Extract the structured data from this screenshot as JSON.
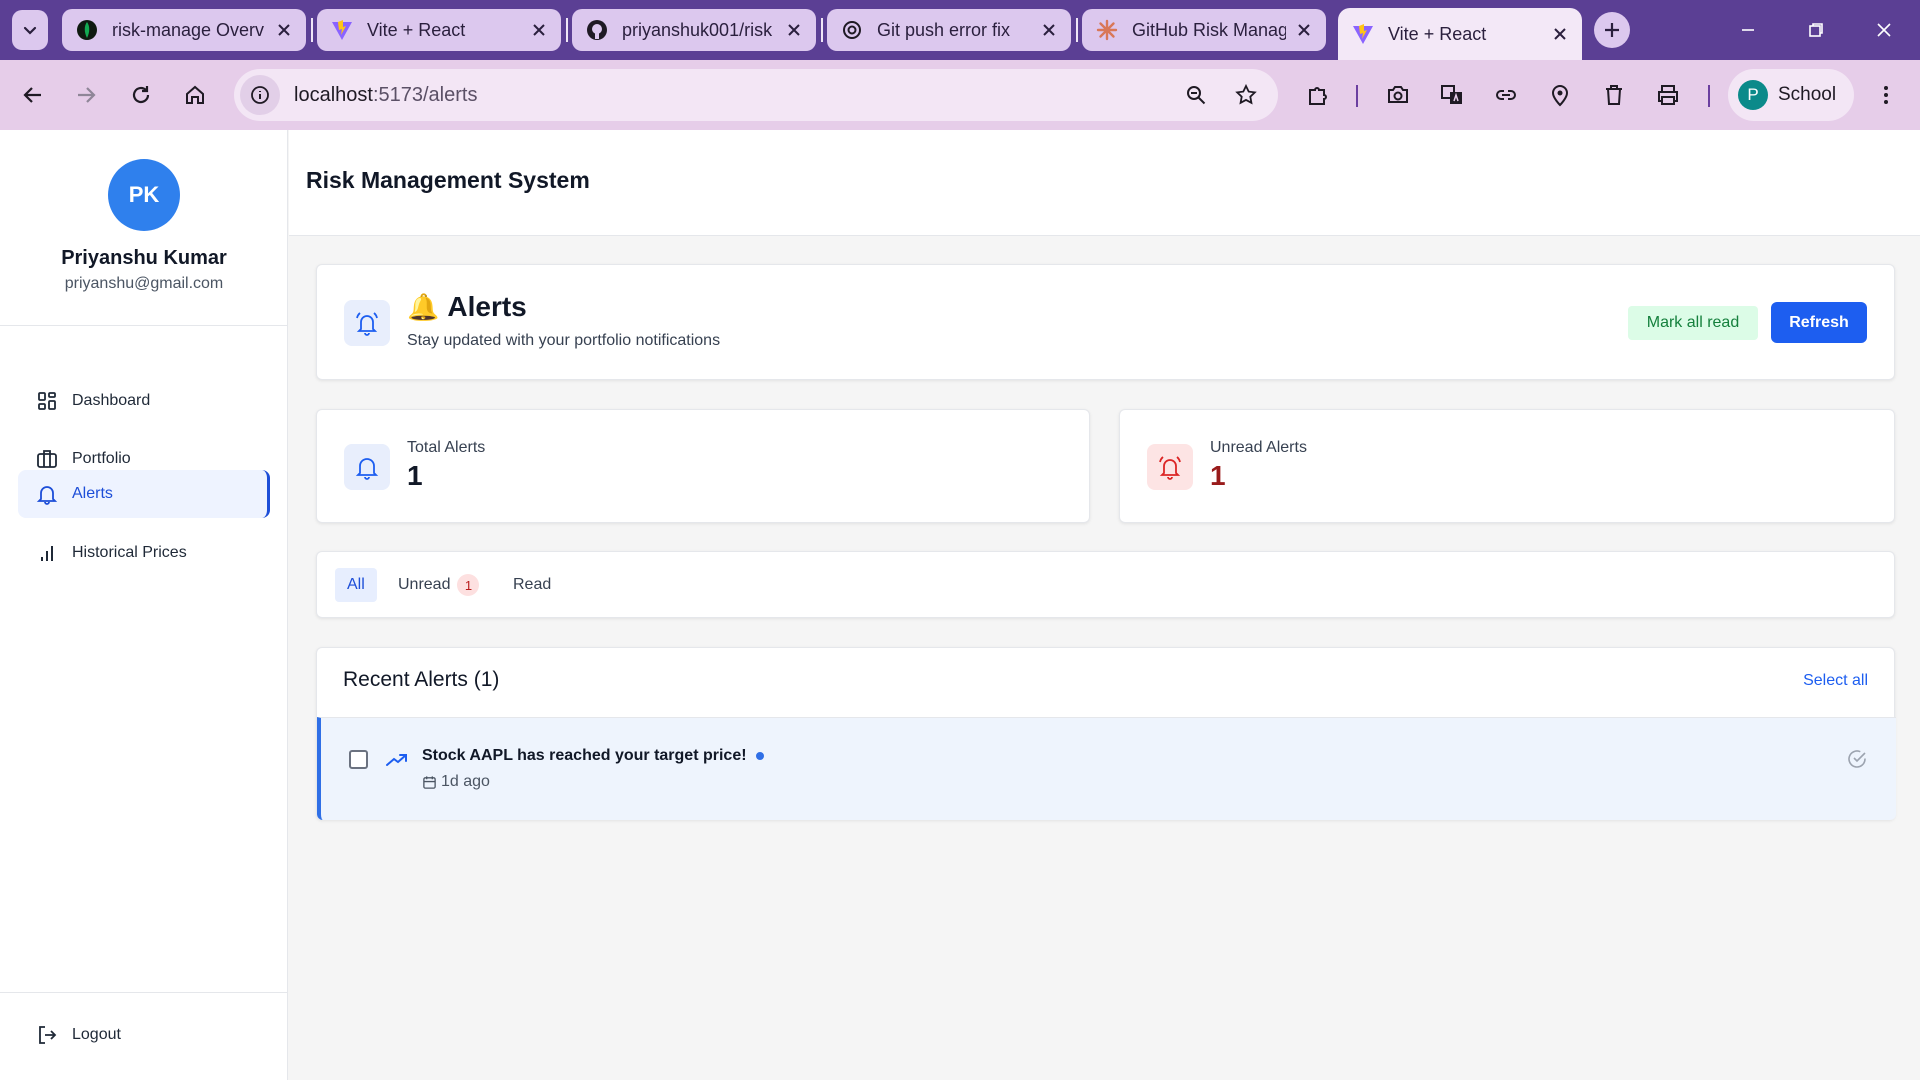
{
  "browser": {
    "tabs": [
      {
        "title": "risk-manage Overv",
        "favicon": "mongodb-leaf-icon"
      },
      {
        "title": "Vite + React",
        "favicon": "vite-icon"
      },
      {
        "title": "priyanshuk001/risk",
        "favicon": "github-icon"
      },
      {
        "title": "Git push error fix",
        "favicon": "openai-icon"
      },
      {
        "title": "GitHub Risk Manag",
        "favicon": "claude-icon"
      },
      {
        "title": "Vite + React",
        "favicon": "vite-icon",
        "active": true
      }
    ],
    "url_host": "localhost",
    "url_path": ":5173/alerts",
    "profile_initial": "P",
    "profile_name": "School"
  },
  "sidebar": {
    "avatar_initials": "PK",
    "user_name": "Priyanshu Kumar",
    "user_email": "priyanshu@gmail.com",
    "items": [
      {
        "label": "Dashboard",
        "icon": "dashboard-grid-icon"
      },
      {
        "label": "Portfolio",
        "icon": "briefcase-icon"
      },
      {
        "label": "Alerts",
        "icon": "bell-icon",
        "active": true
      },
      {
        "label": "Historical Prices",
        "icon": "bar-chart-icon"
      }
    ],
    "logout_label": "Logout"
  },
  "header": {
    "app_title": "Risk Management System"
  },
  "alerts_page": {
    "emoji": "🔔",
    "title": "Alerts",
    "subtitle": "Stay updated with your portfolio notifications",
    "mark_all_read_label": "Mark all read",
    "refresh_label": "Refresh"
  },
  "stats": {
    "total_label": "Total Alerts",
    "total_value": "1",
    "unread_label": "Unread Alerts",
    "unread_value": "1"
  },
  "filters": {
    "all_label": "All",
    "unread_label": "Unread",
    "unread_count": "1",
    "read_label": "Read",
    "active": "All"
  },
  "recent": {
    "title": "Recent Alerts (1)",
    "select_all_label": "Select all",
    "alerts": [
      {
        "message": "Stock AAPL has reached your target price!",
        "time": "1d ago",
        "unread": true,
        "icon": "trending-up-icon"
      }
    ]
  },
  "colors": {
    "tabstrip": "#5b3f94",
    "toolbar": "#e6cde9",
    "accent_blue": "#1d5ef0",
    "unread_red": "#991b1b",
    "mark_read_bg": "#dcfce7",
    "mark_read_text": "#15803d"
  }
}
